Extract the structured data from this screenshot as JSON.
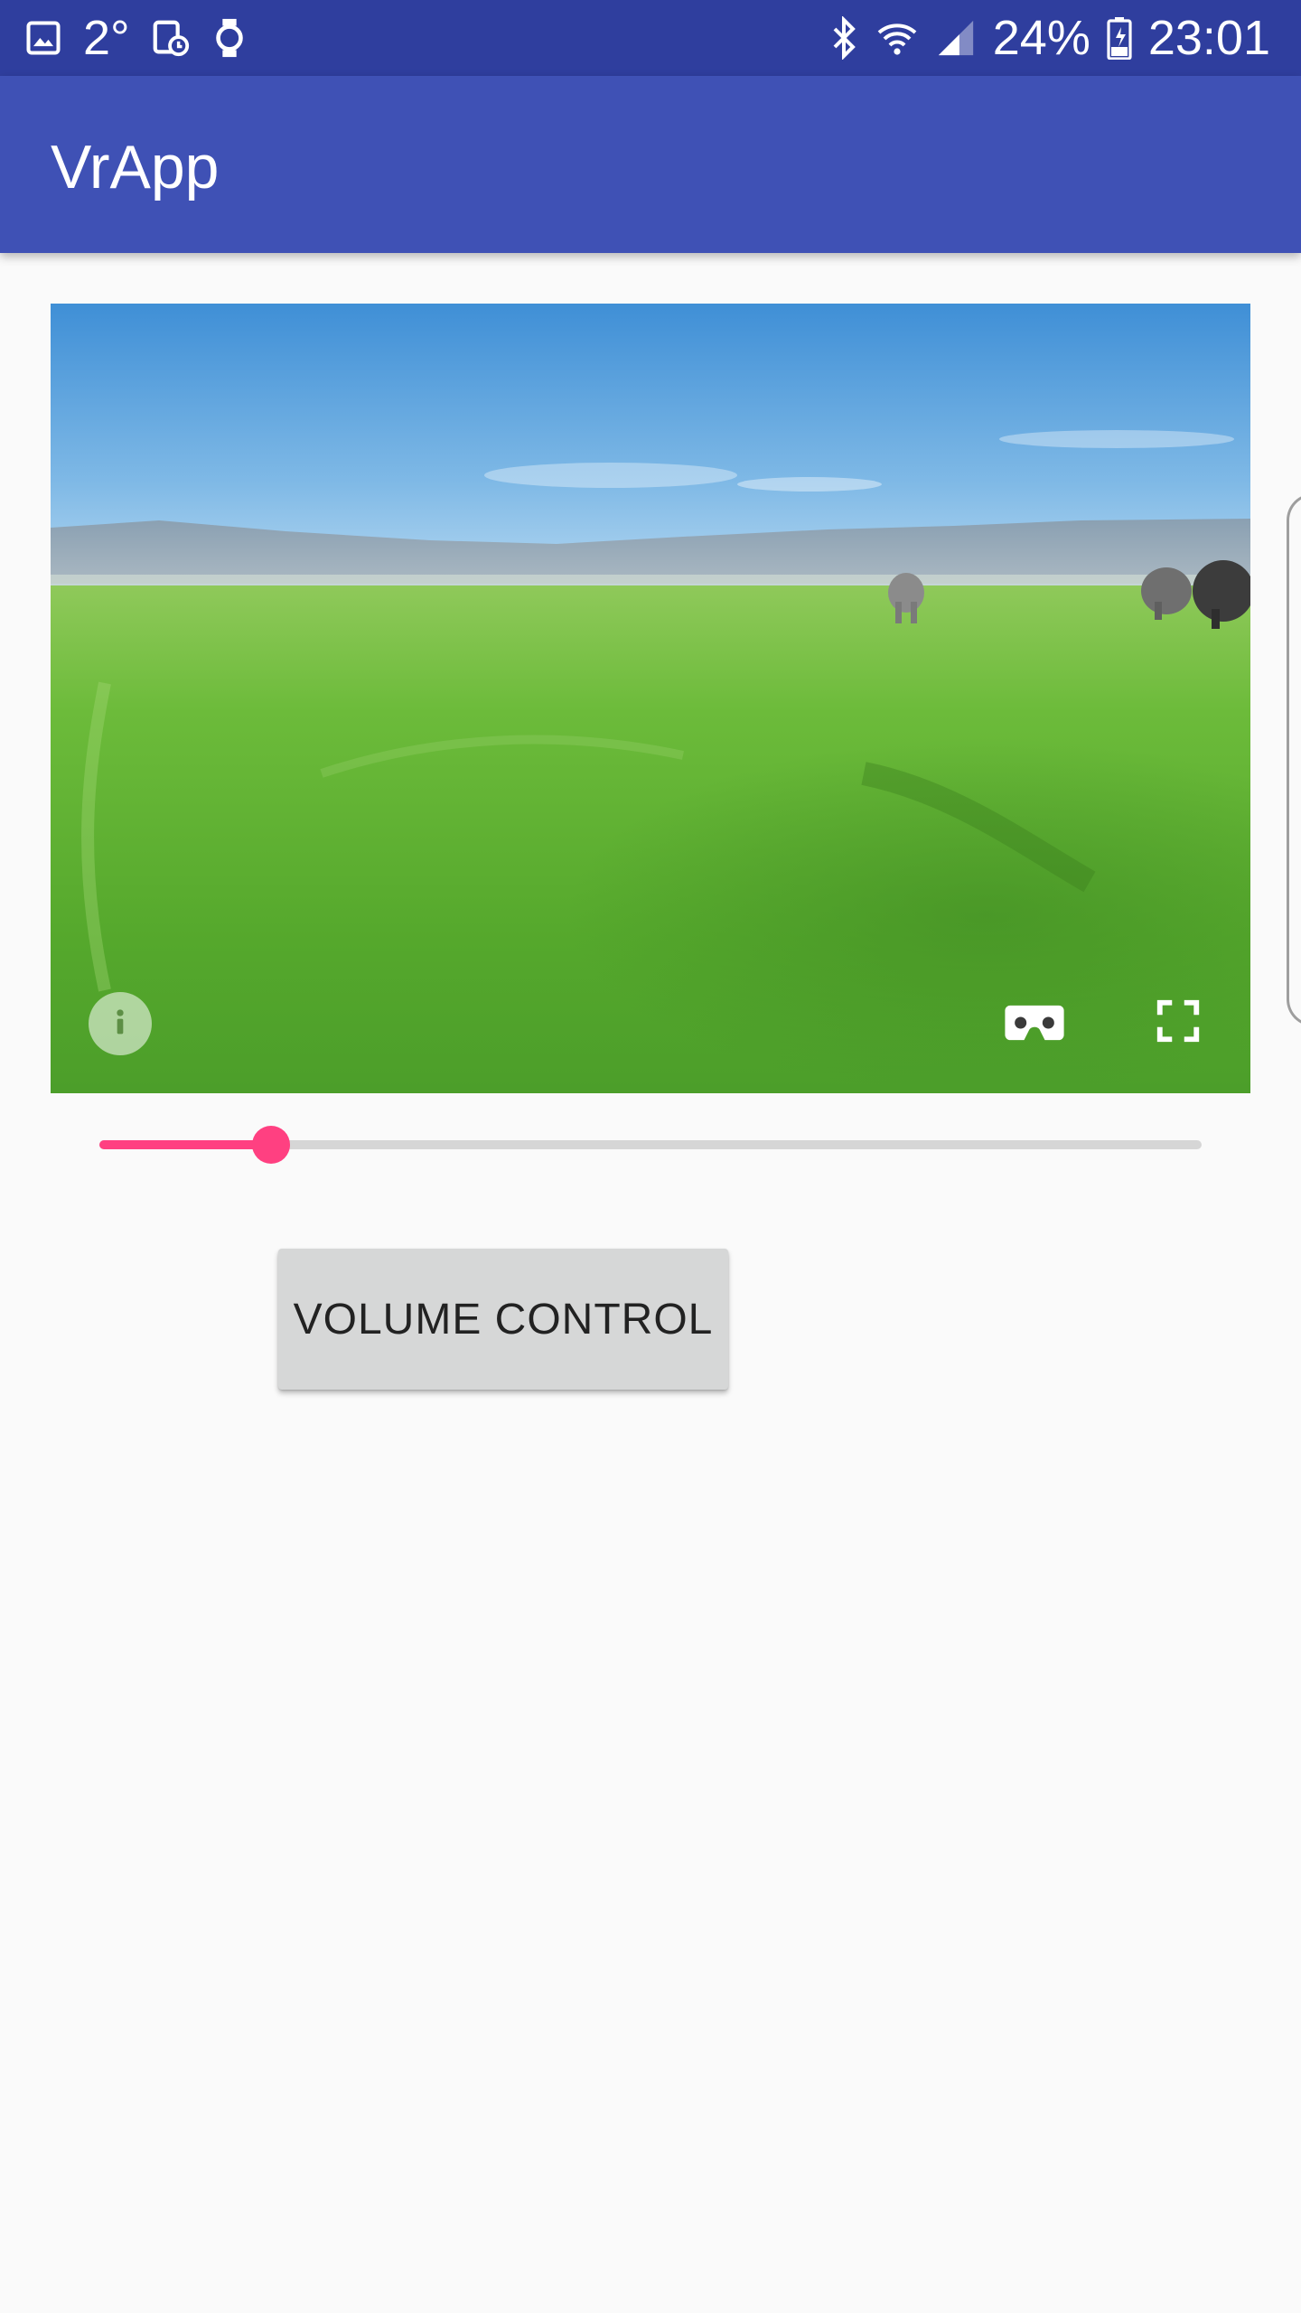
{
  "status_bar": {
    "temperature": "2°",
    "battery": "24%",
    "time": "23:01",
    "icons_left": [
      "image-icon",
      "temperature-text",
      "calendar-clock-icon",
      "smartwatch-icon"
    ],
    "icons_right": [
      "bluetooth-icon",
      "wifi-icon",
      "signal-icon",
      "battery-icon"
    ],
    "background": "#2f3e9e"
  },
  "app_bar": {
    "title": "VrApp",
    "background": "#3f51b5"
  },
  "vr_view": {
    "controls": [
      "info-icon",
      "cardboard-icon",
      "fullscreen-icon"
    ]
  },
  "seekbar": {
    "progress": 0.156,
    "accent": "#ff4081"
  },
  "volume_button": {
    "label": "VOLUME CONTROL"
  }
}
